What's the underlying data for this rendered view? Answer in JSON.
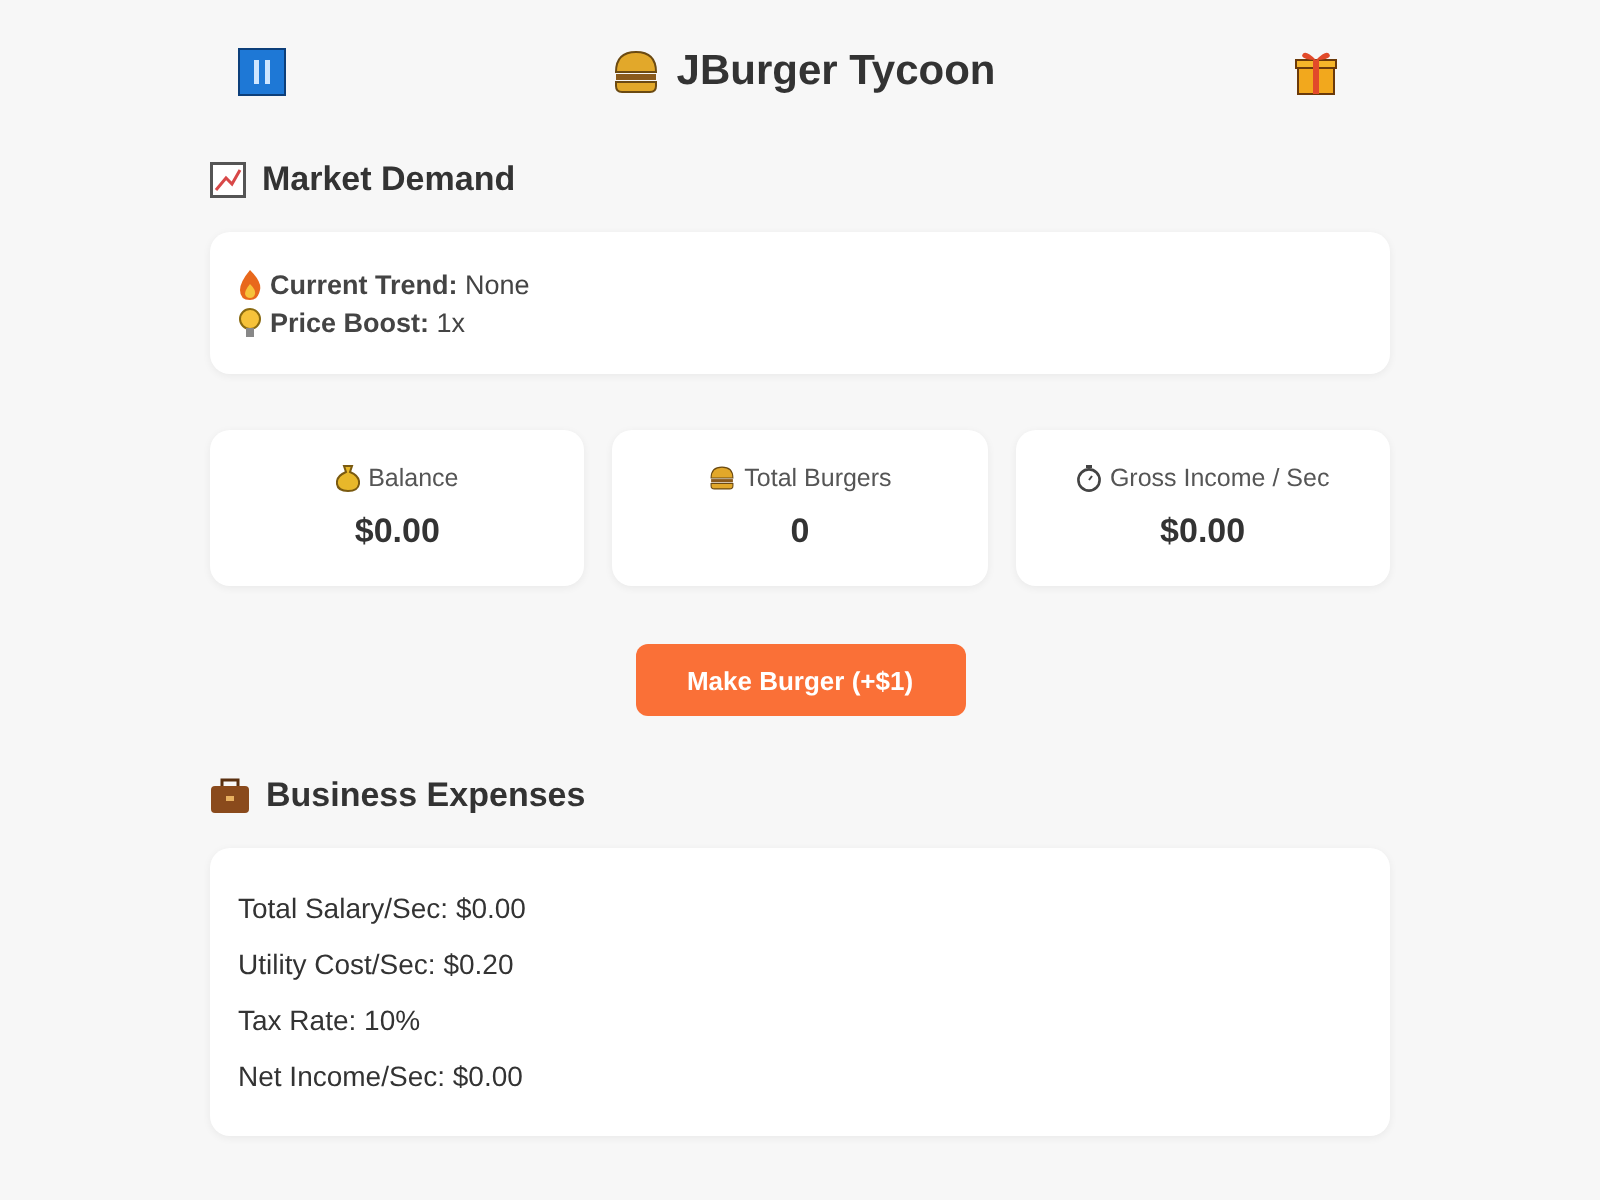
{
  "header": {
    "title": "JBurger Tycoon"
  },
  "market": {
    "heading": "Market Demand",
    "lines": [
      {
        "text": "**Current Trend:** None"
      },
      {
        "text": "**Price Boost:** 1x"
      }
    ]
  },
  "stats": [
    {
      "label": "Balance",
      "value": "$0.00"
    },
    {
      "label": "Total Burgers",
      "value": "0"
    },
    {
      "label": "Gross Income / Sec",
      "value": "$0.00"
    }
  ],
  "make_button": "Make Burger (+$1)",
  "expenses": {
    "heading": "Business Expenses",
    "lines": [
      "Total Salary/Sec: $0.00",
      "Utility Cost/Sec: $0.20",
      "Tax Rate: 10%",
      "Net Income/Sec: $0.00"
    ]
  }
}
